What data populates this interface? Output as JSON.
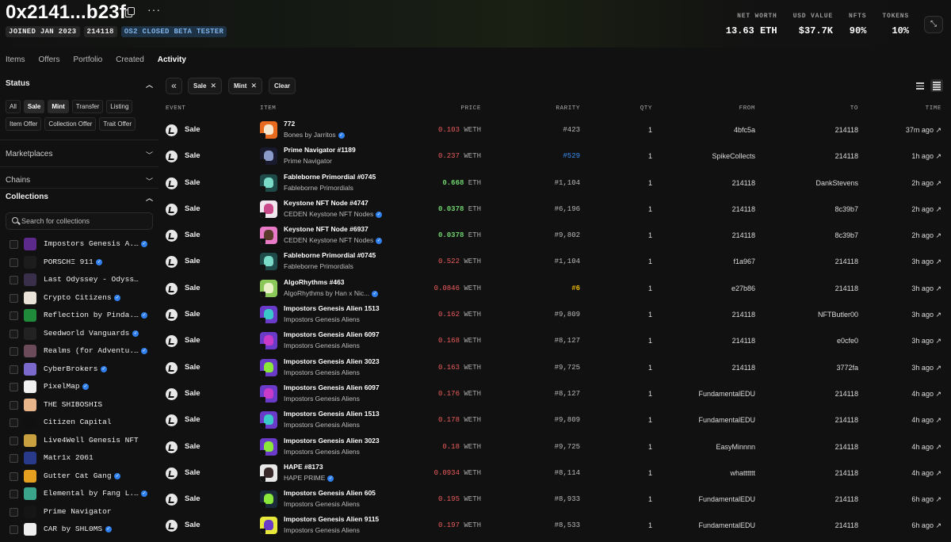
{
  "header": {
    "address": "0x2141...b23f",
    "badges": [
      "JOINED JAN 2023",
      "214118",
      "OS2 CLOSED BETA TESTER"
    ],
    "stats": [
      {
        "label": "NET WORTH",
        "value": "13.63 ETH"
      },
      {
        "label": "USD VALUE",
        "value": "$37.7K"
      },
      {
        "label": "NFTS",
        "value": "90%"
      },
      {
        "label": "TOKENS",
        "value": "10%"
      }
    ]
  },
  "tabs": [
    "Items",
    "Offers",
    "Portfolio",
    "Created",
    "Activity"
  ],
  "active_tab": "Activity",
  "sidebar": {
    "status_title": "Status",
    "status_chips": [
      "All",
      "Sale",
      "Mint",
      "Transfer",
      "Listing",
      "Item Offer",
      "Collection Offer",
      "Trait Offer"
    ],
    "selected_chips": [
      "Sale",
      "Mint"
    ],
    "marketplaces_title": "Marketplaces",
    "chains_title": "Chains",
    "collections_title": "Collections",
    "search_placeholder": "Search for collections",
    "collections": [
      {
        "name": "Impostors Genesis A...",
        "verified": true,
        "color": "#5b2a8a"
      },
      {
        "name": "PORSCHΞ 911",
        "verified": true,
        "color": "#1c1c1c"
      },
      {
        "name": "Last Odyssey - Odysse...",
        "verified": false,
        "color": "#3a2f4a"
      },
      {
        "name": "Crypto Citizens",
        "verified": true,
        "color": "#e8e2d8"
      },
      {
        "name": "Reflection by Pinda...",
        "verified": true,
        "color": "#1f8a3a"
      },
      {
        "name": "Seedworld Vanguards",
        "verified": true,
        "color": "#222222"
      },
      {
        "name": "Realms (for Adventu...",
        "verified": true,
        "color": "#6b4a5a"
      },
      {
        "name": "CyberBrokers",
        "verified": true,
        "color": "#7b6acb"
      },
      {
        "name": "PixelMap",
        "verified": true,
        "color": "#f0f0f0"
      },
      {
        "name": "THE SHIBOSHIS",
        "verified": false,
        "color": "#e8b48a"
      },
      {
        "name": "Citizen Capital",
        "verified": false,
        "color": "#101010"
      },
      {
        "name": "Live4Well Genesis NFT",
        "verified": false,
        "color": "#c8a040"
      },
      {
        "name": "Matr1x 2061",
        "verified": false,
        "color": "#2a3a8a"
      },
      {
        "name": "Gutter Cat Gang",
        "verified": true,
        "color": "#e6a020"
      },
      {
        "name": "Elemental by Fang L...",
        "verified": true,
        "color": "#3aa58a"
      },
      {
        "name": "Prime Navigator",
        "verified": false,
        "color": "#151515"
      },
      {
        "name": "CAR by SHL0MS",
        "verified": true,
        "color": "#eeeeee"
      }
    ]
  },
  "filters": {
    "active": [
      "Sale",
      "Mint"
    ],
    "clear_label": "Clear"
  },
  "table": {
    "headers": {
      "event": "EVENT",
      "item": "ITEM",
      "price": "PRICE",
      "rarity": "RARITY",
      "qty": "QTY",
      "from": "FROM",
      "to": "TO",
      "time": "TIME"
    },
    "rows": [
      {
        "event": "Sale",
        "item": "772",
        "collection": "Bones by Jarritos",
        "verified": true,
        "amount": "0.103",
        "currency": "WETH",
        "price_color": "red",
        "rarity": "#423",
        "rarity_color": "gray",
        "qty": "1",
        "from": "4bfc5a",
        "to": "214118",
        "time": "37m ago ↗",
        "thumb_bg": "#e86a1e",
        "thumb_fg": "#f5e6d0"
      },
      {
        "event": "Sale",
        "item": "Prime Navigator #1189",
        "collection": "Prime Navigator",
        "verified": false,
        "amount": "0.237",
        "currency": "WETH",
        "price_color": "red",
        "rarity": "#529",
        "rarity_color": "blue",
        "qty": "1",
        "from": "SpikeCollects",
        "to": "214118",
        "time": "1h ago ↗",
        "thumb_bg": "#1a1a2e",
        "thumb_fg": "#8a9acb"
      },
      {
        "event": "Sale",
        "item": "Fableborne Primordial #0745",
        "collection": "Fableborne Primordials",
        "verified": false,
        "amount": "0.668",
        "currency": "ETH",
        "price_color": "green",
        "rarity": "#1,104",
        "rarity_color": "gray",
        "qty": "1",
        "from": "214118",
        "to": "DankStevens",
        "time": "2h ago ↗",
        "thumb_bg": "#1e4a4a",
        "thumb_fg": "#7adcc8"
      },
      {
        "event": "Sale",
        "item": "Keystone NFT Node #4747",
        "collection": "CEDEN Keystone NFT Nodes",
        "verified": true,
        "amount": "0.0378",
        "currency": "ETH",
        "price_color": "green",
        "rarity": "#6,196",
        "rarity_color": "gray",
        "qty": "1",
        "from": "214118",
        "to": "8c39b7",
        "time": "2h ago ↗",
        "thumb_bg": "#f0e6ee",
        "thumb_fg": "#c84a8a"
      },
      {
        "event": "Sale",
        "item": "Keystone NFT Node #6937",
        "collection": "CEDEN Keystone NFT Nodes",
        "verified": true,
        "amount": "0.0378",
        "currency": "ETH",
        "price_color": "green",
        "rarity": "#9,802",
        "rarity_color": "gray",
        "qty": "1",
        "from": "214118",
        "to": "8c39b7",
        "time": "2h ago ↗",
        "thumb_bg": "#e87ac8",
        "thumb_fg": "#5a3a2a"
      },
      {
        "event": "Sale",
        "item": "Fableborne Primordial #0745",
        "collection": "Fableborne Primordials",
        "verified": false,
        "amount": "0.522",
        "currency": "WETH",
        "price_color": "red",
        "rarity": "#1,104",
        "rarity_color": "gray",
        "qty": "1",
        "from": "f1a967",
        "to": "214118",
        "time": "3h ago ↗",
        "thumb_bg": "#1e4a4a",
        "thumb_fg": "#7adcc8"
      },
      {
        "event": "Sale",
        "item": "AlgoRhythms #463",
        "collection": "AlgoRhythms by Han x Nic...",
        "verified": true,
        "amount": "0.0846",
        "currency": "WETH",
        "price_color": "red",
        "rarity": "#6",
        "rarity_color": "gold",
        "qty": "1",
        "from": "e27b86",
        "to": "214118",
        "time": "3h ago ↗",
        "thumb_bg": "#8ac85a",
        "thumb_fg": "#e8f0c8"
      },
      {
        "event": "Sale",
        "item": "Impostors Genesis Alien 1513",
        "collection": "Impostors Genesis Aliens",
        "verified": false,
        "amount": "0.162",
        "currency": "WETH",
        "price_color": "red",
        "rarity": "#9,809",
        "rarity_color": "gray",
        "qty": "1",
        "from": "214118",
        "to": "NFTButler00",
        "time": "3h ago ↗",
        "thumb_bg": "#6a3ac8",
        "thumb_fg": "#3ac8c8"
      },
      {
        "event": "Sale",
        "item": "Impostors Genesis Alien 6097",
        "collection": "Impostors Genesis Aliens",
        "verified": false,
        "amount": "0.168",
        "currency": "WETH",
        "price_color": "red",
        "rarity": "#8,127",
        "rarity_color": "gray",
        "qty": "1",
        "from": "214118",
        "to": "e0cfe0",
        "time": "3h ago ↗",
        "thumb_bg": "#6a3ac8",
        "thumb_fg": "#c83ac8"
      },
      {
        "event": "Sale",
        "item": "Impostors Genesis Alien 3023",
        "collection": "Impostors Genesis Aliens",
        "verified": false,
        "amount": "0.163",
        "currency": "WETH",
        "price_color": "red",
        "rarity": "#9,725",
        "rarity_color": "gray",
        "qty": "1",
        "from": "214118",
        "to": "3772fa",
        "time": "3h ago ↗",
        "thumb_bg": "#6a3ac8",
        "thumb_fg": "#8ae83a"
      },
      {
        "event": "Sale",
        "item": "Impostors Genesis Alien 6097",
        "collection": "Impostors Genesis Aliens",
        "verified": false,
        "amount": "0.176",
        "currency": "WETH",
        "price_color": "red",
        "rarity": "#8,127",
        "rarity_color": "gray",
        "qty": "1",
        "from": "FundamentalEDU",
        "to": "214118",
        "time": "4h ago ↗",
        "thumb_bg": "#6a3ac8",
        "thumb_fg": "#c83ac8"
      },
      {
        "event": "Sale",
        "item": "Impostors Genesis Alien 1513",
        "collection": "Impostors Genesis Aliens",
        "verified": false,
        "amount": "0.178",
        "currency": "WETH",
        "price_color": "red",
        "rarity": "#9,809",
        "rarity_color": "gray",
        "qty": "1",
        "from": "FundamentalEDU",
        "to": "214118",
        "time": "4h ago ↗",
        "thumb_bg": "#6a3ac8",
        "thumb_fg": "#3ac8c8"
      },
      {
        "event": "Sale",
        "item": "Impostors Genesis Alien 3023",
        "collection": "Impostors Genesis Aliens",
        "verified": false,
        "amount": "0.18",
        "currency": "WETH",
        "price_color": "red",
        "rarity": "#9,725",
        "rarity_color": "gray",
        "qty": "1",
        "from": "EasyMinnnn",
        "to": "214118",
        "time": "4h ago ↗",
        "thumb_bg": "#6a3ac8",
        "thumb_fg": "#8ae83a"
      },
      {
        "event": "Sale",
        "item": "HAPE #8173",
        "collection": "HAPE PRIME",
        "verified": true,
        "amount": "0.0934",
        "currency": "WETH",
        "price_color": "red",
        "rarity": "#8,114",
        "rarity_color": "gray",
        "qty": "1",
        "from": "whatttttt",
        "to": "214118",
        "time": "4h ago ↗",
        "thumb_bg": "#e8e8e8",
        "thumb_fg": "#3a2a2a"
      },
      {
        "event": "Sale",
        "item": "Impostors Genesis Alien 605",
        "collection": "Impostors Genesis Aliens",
        "verified": false,
        "amount": "0.195",
        "currency": "WETH",
        "price_color": "red",
        "rarity": "#8,933",
        "rarity_color": "gray",
        "qty": "1",
        "from": "FundamentalEDU",
        "to": "214118",
        "time": "6h ago ↗",
        "thumb_bg": "#1a2a3a",
        "thumb_fg": "#8ae83a"
      },
      {
        "event": "Sale",
        "item": "Impostors Genesis Alien 9115",
        "collection": "Impostors Genesis Aliens",
        "verified": false,
        "amount": "0.197",
        "currency": "WETH",
        "price_color": "red",
        "rarity": "#8,533",
        "rarity_color": "gray",
        "qty": "1",
        "from": "FundamentalEDU",
        "to": "214118",
        "time": "6h ago ↗",
        "thumb_bg": "#e8e83a",
        "thumb_fg": "#6a3ac8"
      }
    ]
  },
  "icons": {
    "copy": "copy-icon",
    "more": "more-icon",
    "expand": "expand-icon",
    "collapse": "double-chevron-left-icon",
    "event": "sale-event-icon",
    "verified": "verified-check-icon"
  }
}
